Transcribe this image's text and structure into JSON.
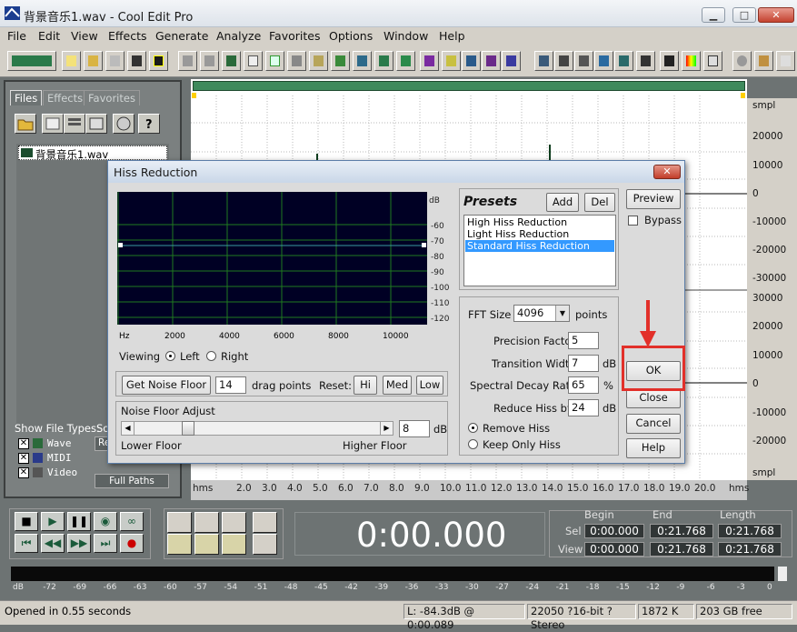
{
  "window": {
    "title": "背景音乐1.wav - Cool Edit Pro",
    "minimize": "▁",
    "maximize": "□",
    "close": "✕"
  },
  "menu": [
    "File",
    "Edit",
    "View",
    "Effects",
    "Generate",
    "Analyze",
    "Favorites",
    "Options",
    "Window",
    "Help"
  ],
  "left": {
    "tabs": [
      "Files",
      "Effects",
      "Favorites"
    ],
    "file": "背景音乐1.wav",
    "show_types_label": "Show File Types:",
    "sort_label": "So",
    "types": [
      "Wave",
      "MIDI",
      "Video"
    ],
    "full_paths": "Full Paths",
    "btn_r": "Re"
  },
  "wave": {
    "ruler_unit": "smpl",
    "ruler_top": [
      "20000",
      "10000",
      "0",
      "-10000",
      "-20000",
      "-30000"
    ],
    "ruler_bottom": [
      "30000",
      "20000",
      "10000",
      "0",
      "-10000",
      "-20000"
    ],
    "ruler_end": "smpl",
    "timeline_start": "hms",
    "timeline_end": "hms",
    "timeline": [
      "2.0",
      "3.0",
      "4.0",
      "5.0",
      "6.0",
      "7.0",
      "8.0",
      "9.0",
      "10.0",
      "11.0",
      "12.0",
      "13.0",
      "14.0",
      "15.0",
      "16.0",
      "17.0",
      "18.0",
      "19.0",
      "20.0"
    ]
  },
  "dialog": {
    "title": "Hiss Reduction",
    "graph": {
      "db_label": "dB",
      "db_ticks": [
        "-60",
        "-70",
        "-80",
        "-90",
        "-100",
        "-110",
        "-120"
      ],
      "hz_label": "Hz",
      "hz_ticks": [
        "2000",
        "4000",
        "6000",
        "8000",
        "10000"
      ],
      "level_db": -70
    },
    "viewing_label": "Viewing",
    "left_label": "Left",
    "right_label": "Right",
    "get_noise_floor": "Get Noise Floor",
    "drag_points_value": "14",
    "drag_points_label": "drag points",
    "reset_label": "Reset:",
    "hi": "Hi",
    "med": "Med",
    "low": "Low",
    "noise_floor_adjust": "Noise Floor Adjust",
    "slider_value": "8",
    "slider_unit": "dB",
    "lower_floor": "Lower Floor",
    "higher_floor": "Higher Floor",
    "presets_title": "Presets",
    "add": "Add",
    "del": "Del",
    "presets": [
      "High Hiss Reduction",
      "Light Hiss Reduction",
      "Standard Hiss Reduction"
    ],
    "selected_preset": "Standard Hiss Reduction",
    "fft_label": "FFT Size",
    "fft_value": "4096",
    "fft_unit": "points",
    "precision_label": "Precision Factor",
    "precision_value": "5",
    "transition_label": "Transition Width",
    "transition_value": "7",
    "transition_unit": "dB",
    "decay_label": "Spectral Decay Rate",
    "decay_value": "65",
    "decay_unit": "%",
    "reduce_label": "Reduce Hiss by",
    "reduce_value": "24",
    "reduce_unit": "dB",
    "remove_hiss": "Remove Hiss",
    "keep_only": "Keep Only Hiss",
    "preview": "Preview",
    "bypass": "Bypass",
    "ok": "OK",
    "close": "Close",
    "cancel": "Cancel",
    "help": "Help"
  },
  "transport": {
    "time": "0:00.000",
    "begin_label": "Begin",
    "end_label": "End",
    "length_label": "Length",
    "sel_label": "Sel",
    "view_label": "View",
    "sel_begin": "0:00.000",
    "sel_end": "0:21.768",
    "sel_length": "0:21.768",
    "view_begin": "0:00.000",
    "view_end": "0:21.768",
    "view_length": "0:21.768"
  },
  "meter": {
    "ticks": [
      "dB",
      "-72",
      "-69",
      "-66",
      "-63",
      "-60",
      "-57",
      "-54",
      "-51",
      "-48",
      "-45",
      "-42",
      "-39",
      "-36",
      "-33",
      "-30",
      "-27",
      "-24",
      "-21",
      "-18",
      "-15",
      "-12",
      "-9",
      "-6",
      "-3",
      "0"
    ]
  },
  "status": {
    "left": "Opened in 0.55 seconds",
    "level": "L: -84.3dB @  0:00.089",
    "format": "22050 ?16-bit ?Stereo",
    "size": "1872 K",
    "free": "203 GB free"
  }
}
